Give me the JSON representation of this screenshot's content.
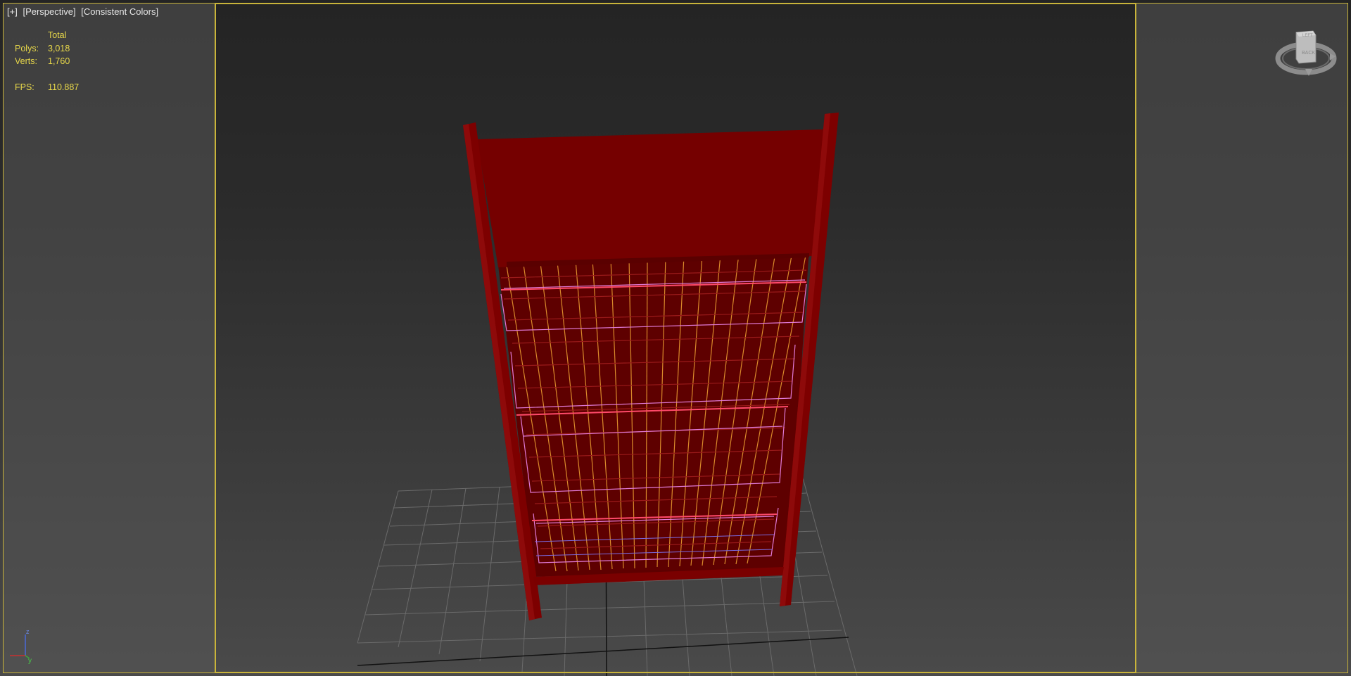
{
  "viewport": {
    "labels": [
      "[+]",
      "[Perspective]",
      "[Consistent Colors]"
    ]
  },
  "stats": {
    "header": "Total",
    "polys_label": "Polys:",
    "polys_value": "3,018",
    "verts_label": "Verts:",
    "verts_value": "1,760",
    "fps_label": "FPS:",
    "fps_value": "110.887"
  },
  "viewcube": {
    "faces": [
      "LEFT",
      "BACK"
    ]
  },
  "axis_gizmo": {
    "z": "z",
    "y": "y"
  },
  "colors": {
    "frame": "#c9b43a",
    "stat_text": "#e8d84a",
    "model_red": "#7a0000",
    "wire_orange": "#d98a2b",
    "wire_pink": "#e07ad8"
  }
}
